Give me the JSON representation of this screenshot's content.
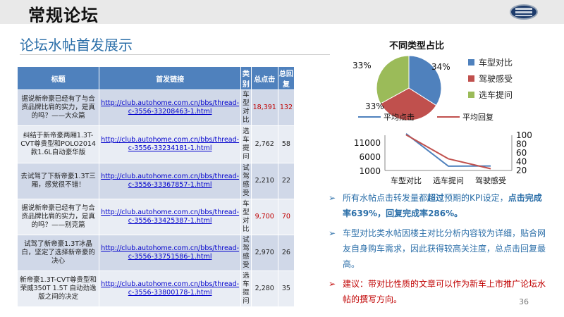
{
  "slide": {
    "title": "常规论坛",
    "subtitle": "论坛水帖首发展示",
    "page_number": "36"
  },
  "table": {
    "headers": [
      "标题",
      "首发链接",
      "类别",
      "总点击",
      "总回复"
    ],
    "rows": [
      {
        "title": "据说新帝豪已经有了与合资品牌比肩的实力，是真的吗？——大众篇",
        "link": "http://club.autohome.com.cn/bbs/thread-c-3556-33208463-1.html",
        "category": "车型对比",
        "clicks": "18,391",
        "replies": "132",
        "highlight": true
      },
      {
        "title": "纠结于新帝豪两厢1.3T-CVT尊贵型和POLO2014款1.6L自动豪华版",
        "link": "http://club.autohome.com.cn/bbs/thread-c-3556-33234181-1.html",
        "category": "选车提问",
        "clicks": "2,762",
        "replies": "58",
        "highlight": false
      },
      {
        "title": "去试驾了下新帝豪1.3T三厢，感觉很不错！",
        "link": "http://club.autohome.com.cn/bbs/thread-c-3556-33367857-1.html",
        "category": "试驾感受",
        "clicks": "2,210",
        "replies": "22",
        "highlight": false
      },
      {
        "title": "据说新帝豪已经有了与合资品牌比肩的实力，是真的吗？——别克篇",
        "link": "http://club.autohome.com.cn/bbs/thread-c-3556-33425387-1.html",
        "category": "车型对比",
        "clicks": "9,700",
        "replies": "70",
        "highlight": true
      },
      {
        "title": "试驾了新帝豪1.3T冰晶白，坚定了选择新帝豪的决心",
        "link": "http://club.autohome.com.cn/bbs/thread-c-3556-33751586-1.html",
        "category": "试驾感受",
        "clicks": "2,970",
        "replies": "26",
        "highlight": false
      },
      {
        "title": "新帝豪1.3T-CVT尊贵型和荣威350T 1.5T 自动劲逸版之间的决定",
        "link": "http://club.autohome.com.cn/bbs/thread-c-3556-33800178-1.html",
        "category": "选车提问",
        "clicks": "2,280",
        "replies": "35",
        "highlight": false
      }
    ]
  },
  "chart_data": [
    {
      "type": "pie",
      "title": "不同类型占比",
      "categories": [
        "车型对比",
        "驾驶感受",
        "选车提问"
      ],
      "values": [
        34,
        33,
        33
      ],
      "labels": [
        "34%",
        "33%",
        "33%"
      ],
      "colors": [
        "#4f81bd",
        "#c0504d",
        "#9bbb59"
      ],
      "legend": "right"
    },
    {
      "type": "line",
      "categories": [
        "车型对比",
        "选车提问",
        "驾驶感受"
      ],
      "series": [
        {
          "name": "平均点击",
          "values": [
            14045,
            2521,
            2590
          ],
          "axis": "left",
          "color": "#4f81bd"
        },
        {
          "name": "平均回复",
          "values": [
            101,
            46.5,
            24
          ],
          "axis": "right",
          "color": "#c0504d"
        }
      ],
      "y_left_ticks": [
        "11000",
        "6000",
        "1000"
      ],
      "y_right_ticks": [
        "100",
        "80",
        "60",
        "40",
        "20"
      ],
      "ylim_left": [
        1000,
        11000
      ],
      "ylim_right": [
        20,
        100
      ],
      "legend": "top"
    }
  ],
  "bullets": [
    {
      "parts": [
        {
          "text": "所有水帖点击转发量都",
          "style": "normal"
        },
        {
          "text": "超过",
          "style": "bold"
        },
        {
          "text": "预期的KPI设定，",
          "style": "normal"
        },
        {
          "text": "点击完成率639%，回复完成率286%。",
          "style": "bold"
        }
      ],
      "color": "#2a6ea8"
    },
    {
      "parts": [
        {
          "text": "车型对比类水帖因楼主对比分析内容较为详细，贴合网友自身购车需求，因此获得较高关注度，总点击回复最高。",
          "style": "normal"
        }
      ],
      "color": "#2a6ea8"
    },
    {
      "parts": [
        {
          "text": "建议：带对比性质的文章可以作为新车上市推广论坛水帖的撰写方向。",
          "style": "normal"
        }
      ],
      "color": "#c00000"
    }
  ]
}
